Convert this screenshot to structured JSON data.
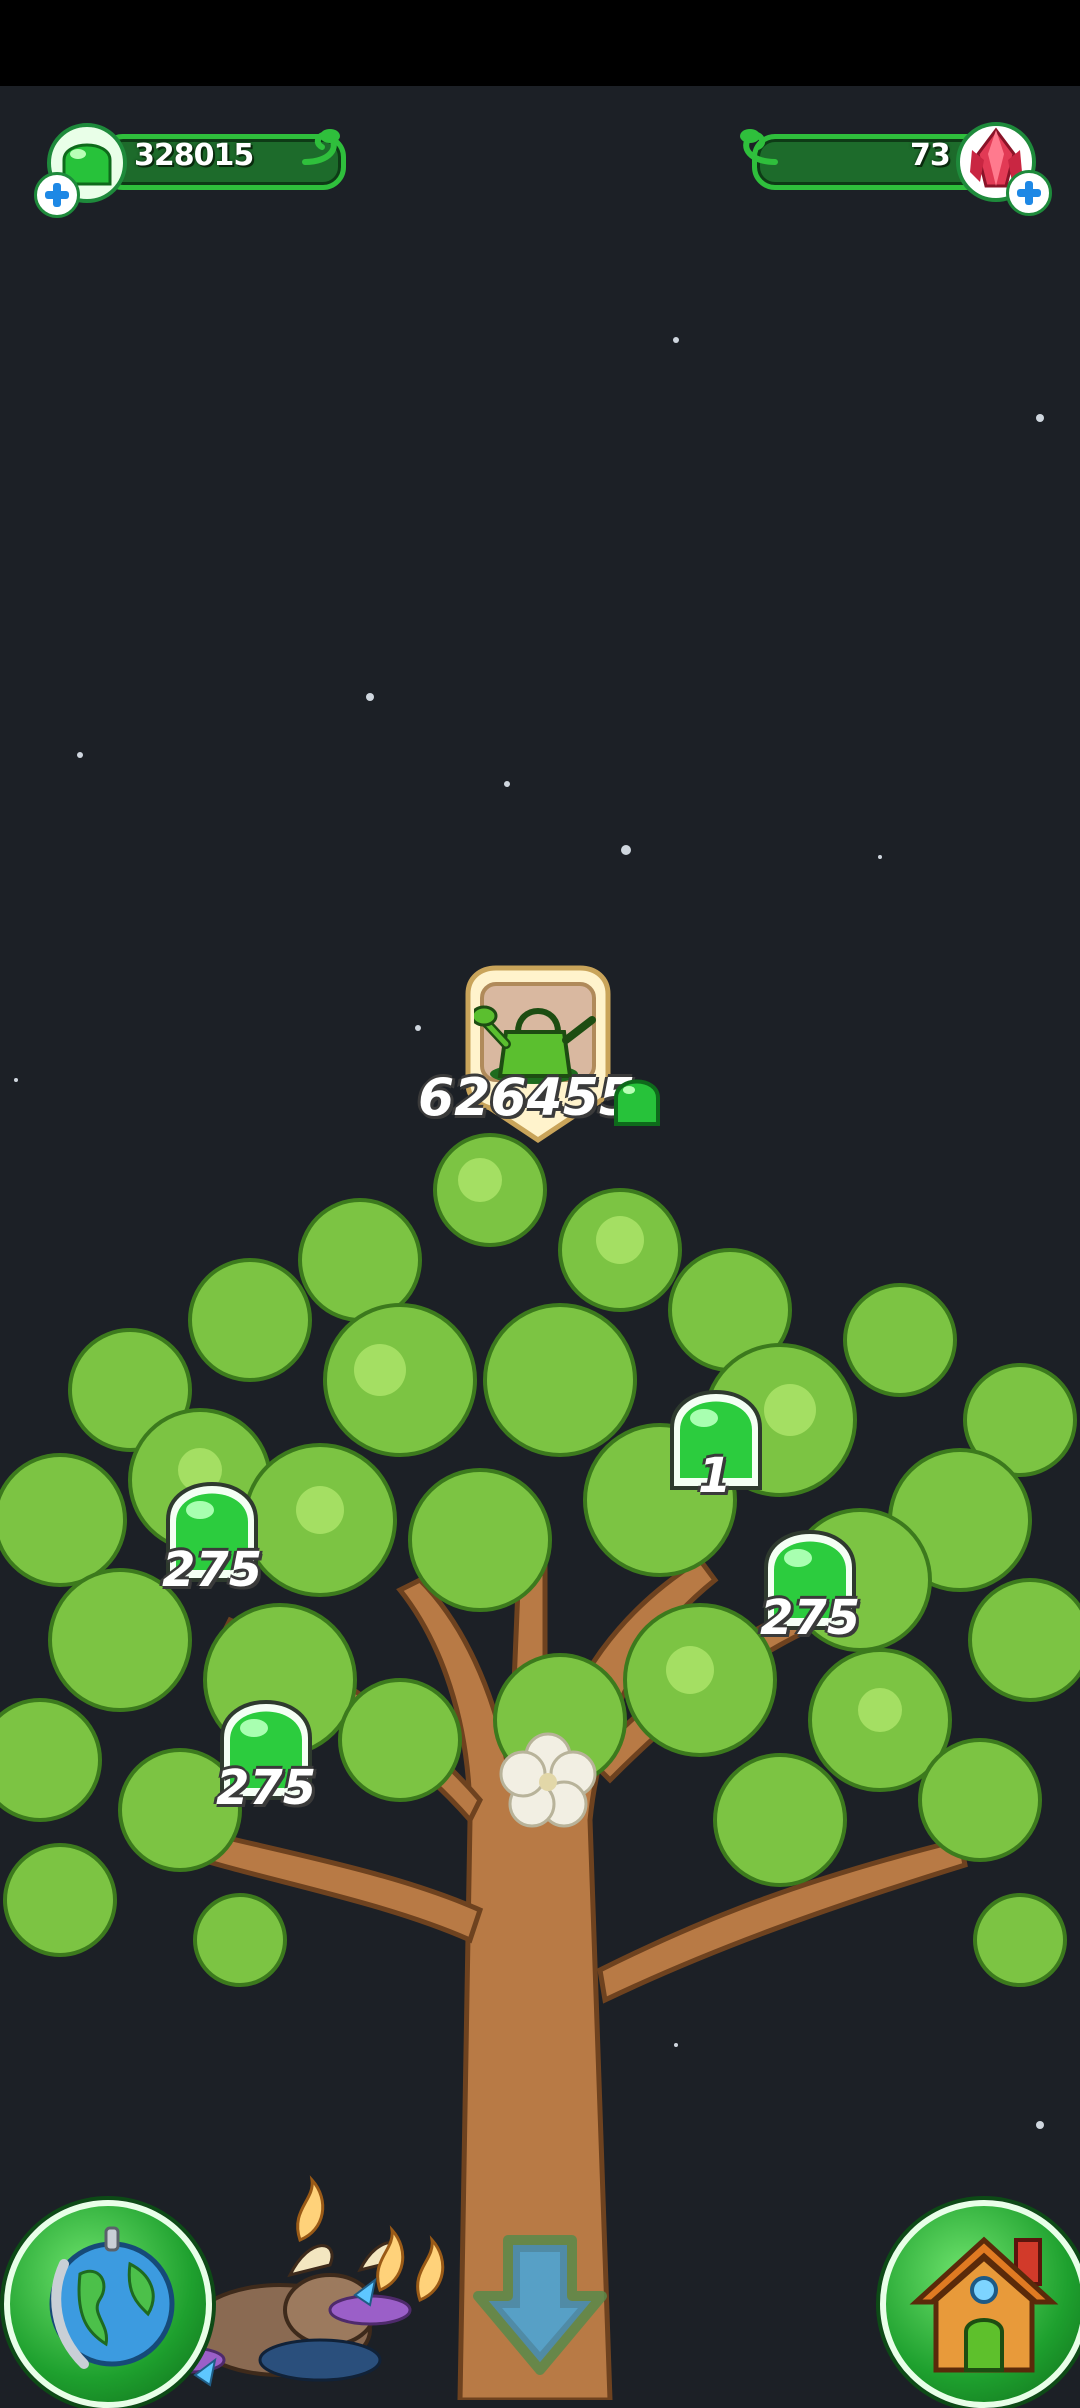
{
  "hud": {
    "gems": "328015",
    "crystals": "73"
  },
  "watering": {
    "cost": "626455"
  },
  "drops": [
    {
      "value": "1"
    },
    {
      "value": "275"
    },
    {
      "value": "275"
    },
    {
      "value": "275"
    }
  ],
  "colors": {
    "background": "#1c2026",
    "hud_green": "#2fbf3c",
    "leaf": "#7cc443",
    "trunk": "#b87a45"
  },
  "icons": {
    "gem": "green-gem-icon",
    "crystal": "red-crystal-icon",
    "watering_can": "watering-can-icon",
    "globe": "globe-icon",
    "house": "house-icon",
    "down_arrow": "down-arrow-icon"
  }
}
